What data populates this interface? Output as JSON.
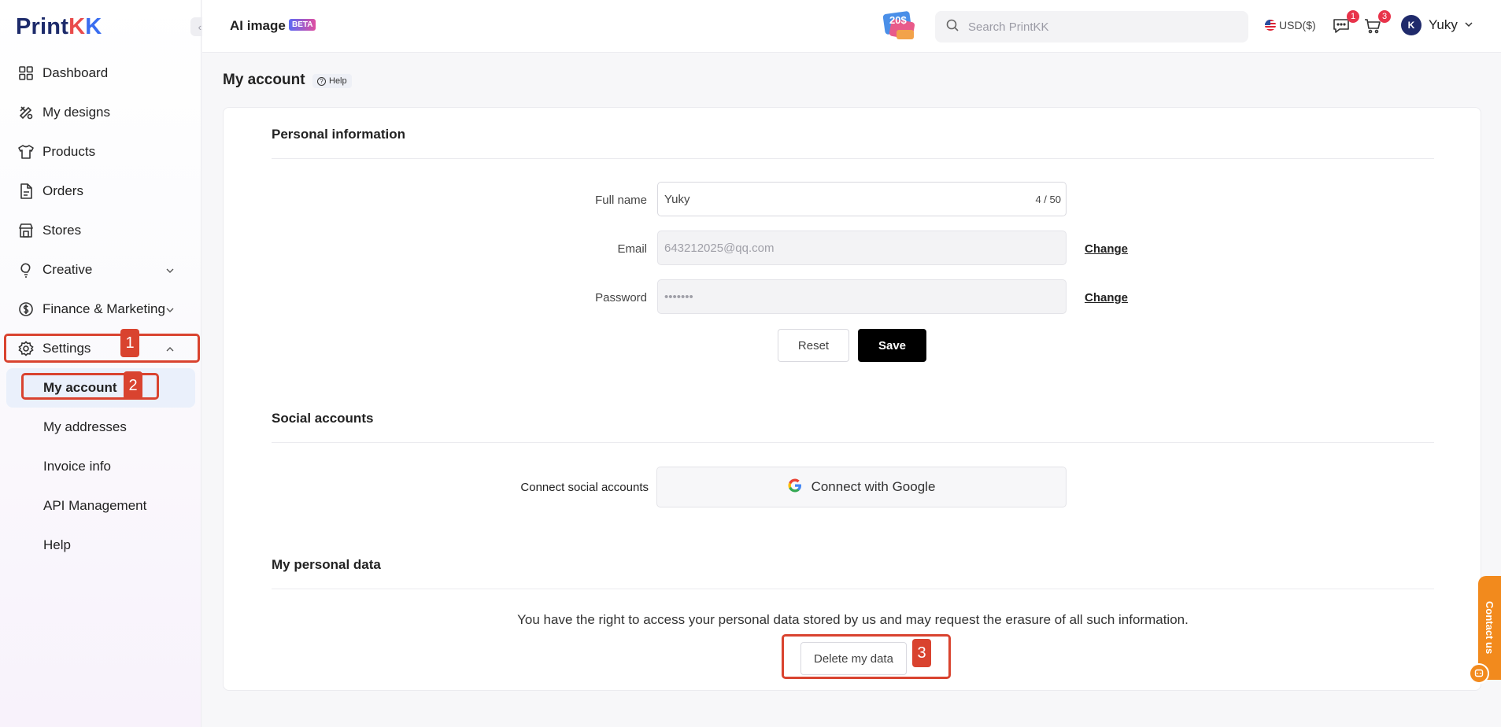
{
  "sidebar": {
    "logo": {
      "main": "Print",
      "k1": "K",
      "k2": "K"
    },
    "collapse_glyph": "‹›",
    "items": [
      {
        "label": "Dashboard",
        "icon": "dashboard-icon"
      },
      {
        "label": "My designs",
        "icon": "designs-icon"
      },
      {
        "label": "Products",
        "icon": "tshirt-icon"
      },
      {
        "label": "Orders",
        "icon": "document-icon"
      },
      {
        "label": "Stores",
        "icon": "store-icon"
      },
      {
        "label": "Creative",
        "icon": "bulb-icon"
      },
      {
        "label": "Finance & Marketing",
        "icon": "dollar-icon"
      },
      {
        "label": "Settings",
        "icon": "gear-icon"
      }
    ],
    "settings_sub": [
      {
        "label": "My account"
      },
      {
        "label": "My addresses"
      },
      {
        "label": "Invoice info"
      },
      {
        "label": "API Management"
      },
      {
        "label": "Help"
      }
    ]
  },
  "annotations": [
    "1",
    "2",
    "3"
  ],
  "topbar": {
    "ai_title": "AI image",
    "beta": "BETA",
    "promo_text": "20$",
    "search_placeholder": "Search PrintKK",
    "currency": "USD($)",
    "messages_badge": "1",
    "cart_badge": "3",
    "user_name": "Yuky",
    "avatar_text": "K"
  },
  "main": {
    "page_title": "My account",
    "help_label": "Help",
    "personal": {
      "title": "Personal information",
      "full_name_label": "Full name",
      "full_name_value": "Yuky",
      "full_name_count": "4 / 50",
      "email_label": "Email",
      "email_value": "643212025@qq.com",
      "password_label": "Password",
      "password_value": "•••••••",
      "change_label": "Change",
      "reset_label": "Reset",
      "save_label": "Save"
    },
    "social": {
      "title": "Social accounts",
      "connect_label": "Connect social accounts",
      "google_label": "Connect with Google"
    },
    "data": {
      "title": "My personal data",
      "text": "You have the right to access your personal data stored by us and may request the erasure of all such information.",
      "delete_label": "Delete my data"
    }
  },
  "contact": {
    "label": "Contact us"
  },
  "colors": {
    "accent": "#d9432f",
    "primary": "#000000",
    "badge": "#e8334a",
    "contact": "#f28a1d"
  }
}
